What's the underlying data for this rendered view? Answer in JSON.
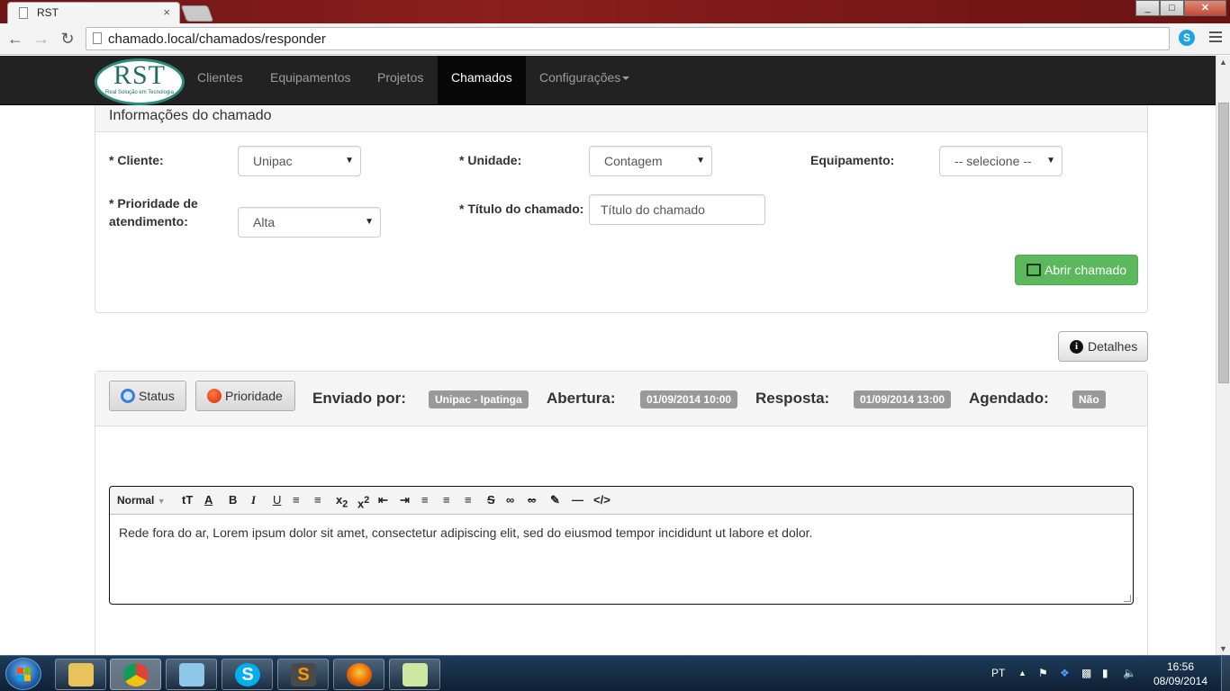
{
  "browser": {
    "tab_title": "RST",
    "tab_close": "×",
    "url": "chamado.local/chamados/responder",
    "window_min": "_",
    "window_max": "□",
    "window_close": "✕",
    "skype_letter": "S"
  },
  "navbar": {
    "logo_text": "RST",
    "logo_tagline": "Real Solução em Tecnologia",
    "links": [
      "Clientes",
      "Equipamentos",
      "Projetos",
      "Chamados",
      "Configurações"
    ],
    "active": "Chamados"
  },
  "form": {
    "panel_title": "Informações do chamado",
    "cliente_label": "* Cliente:",
    "cliente_value": "Unipac",
    "unidade_label": "* Unidade:",
    "unidade_value": "Contagem",
    "equipamento_label": "Equipamento:",
    "equipamento_value": "-- selecione --",
    "prioridade_label_1": "* Prioridade de",
    "prioridade_label_2": "atendimento:",
    "prioridade_value": "Alta",
    "titulo_label": "* Título do chamado:",
    "titulo_placeholder": "Título do chamado",
    "submit_label": "Abrir chamado"
  },
  "detalhes_label": "Detalhes",
  "ticket": {
    "status_label": "Status",
    "prioridade_label": "Prioridade",
    "enviado_label": "Enviado por:",
    "enviado_value": "Unipac - Ipatinga",
    "abertura_label": "Abertura:",
    "abertura_value": "01/09/2014 10:00",
    "resposta_label": "Resposta:",
    "resposta_value": "01/09/2014 13:00",
    "agendado_label": "Agendado:",
    "agendado_value": "Não"
  },
  "editor": {
    "format_select": "Normal",
    "content": "Rede fora do ar, Lorem ipsum dolor sit amet, consectetur adipiscing elit, sed do eiusmod tempor incididunt ut labore et dolor."
  },
  "taskbar": {
    "lang": "PT",
    "time": "16:56",
    "date": "08/09/2014",
    "skype_letter": "S",
    "sublime_letter": "S"
  },
  "colors": {
    "navbar_bg": "#222222",
    "primary_green": "#5cb85c",
    "badge_gray": "#999999",
    "chrome_frame": "#8b1e1e"
  }
}
